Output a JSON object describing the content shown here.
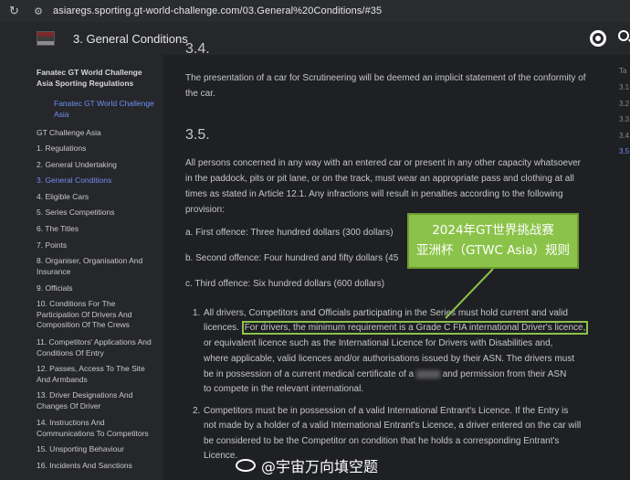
{
  "browser": {
    "url": "asiaregs.sporting.gt-world-challenge.com/03.General%20Conditions/#35"
  },
  "header": {
    "title": "3. General Conditions"
  },
  "sidebar": {
    "book_title": "Fanatec GT World Challenge Asia Sporting Regulations",
    "book_sub": "Fanatec GT World Challenge Asia",
    "items": [
      "GT Challenge Asia",
      "1. Regulations",
      "2. General Undertaking",
      "3. General Conditions",
      "4. Eligible Cars",
      "5. Series Competitions",
      "6. The Titles",
      "7. Points",
      "8. Organiser, Organisation And Insurance",
      "9. Officials",
      "10. Conditions For The Participation Of Drivers And Composition Of The Crews",
      "11. Competitors' Applications And Conditions Of Entry",
      "12. Passes, Access To The Site And Armbands",
      "13. Driver Designations And Changes Of Driver",
      "14. Instructions And Communications To Competitors",
      "15. Unsporting Behaviour",
      "16. Incidents And Sanctions"
    ]
  },
  "content": {
    "top_partial_heading": "3.4.",
    "p_scrutineering": "The presentation of a car for Scrutineering will be deemed an implicit statement of the conformity of the car.",
    "heading_35": "3.5.",
    "p_35": "All persons concerned in any way with an entered car or present in any other capacity whatsoever in the paddock, pits or pit lane, or on the track, must wear an appropriate pass and clothing at all times as stated in Article 12.1. Any infractions will result in penalties according to the following provision:",
    "offence_a": "a. First offence: Three hundred dollars (300 dollars)",
    "offence_b": "b. Second offence: Four hundred and fifty dollars (45",
    "offence_c": "c. Third offence: Six hundred dollars (600 dollars)",
    "li1_num": "1.",
    "li1_line1": "All drivers, Competitors and Officials participating in the Series must hold current and valid",
    "li1_prefix": "licences.",
    "li1_highlight": "For drivers, the minimum requirement is a Grade C FIA international Driver's licence,",
    "li1_line3": "or equivalent licence such as the International Licence for Drivers with Disabilities and,",
    "li1_line4": "where applicable, valid licences and/or authorisations issued by their ASN. The drivers must",
    "li1_line5": "be in possession of a current medical certificate of a",
    "li1_line5b": "and permission from their ASN",
    "li1_line6": "to compete in the relevant international.",
    "li2_num": "2.",
    "li2_line1": "Competitors must be in possession of a valid International Entrant's Licence. If the Entry is",
    "li2_line2": "not made by a holder of a valid International Entrant's Licence, a driver entered on the car will",
    "li2_line3": "be considered to be the Competitor on condition that he holds a corresponding Entrant's",
    "li2_line4": "Licence."
  },
  "annotation": {
    "line1": "2024年GT世界挑战赛",
    "line2": "亚洲杯（GTWC Asia）规则"
  },
  "toc": {
    "items": [
      "Ta",
      "3.1",
      "3.2",
      "3.3",
      "3.4",
      "3.5"
    ]
  },
  "watermark": {
    "text": "@宇宙万向填空题"
  },
  "colors": {
    "accent": "#6f8ef2",
    "annotation_green": "#8bc34a"
  }
}
